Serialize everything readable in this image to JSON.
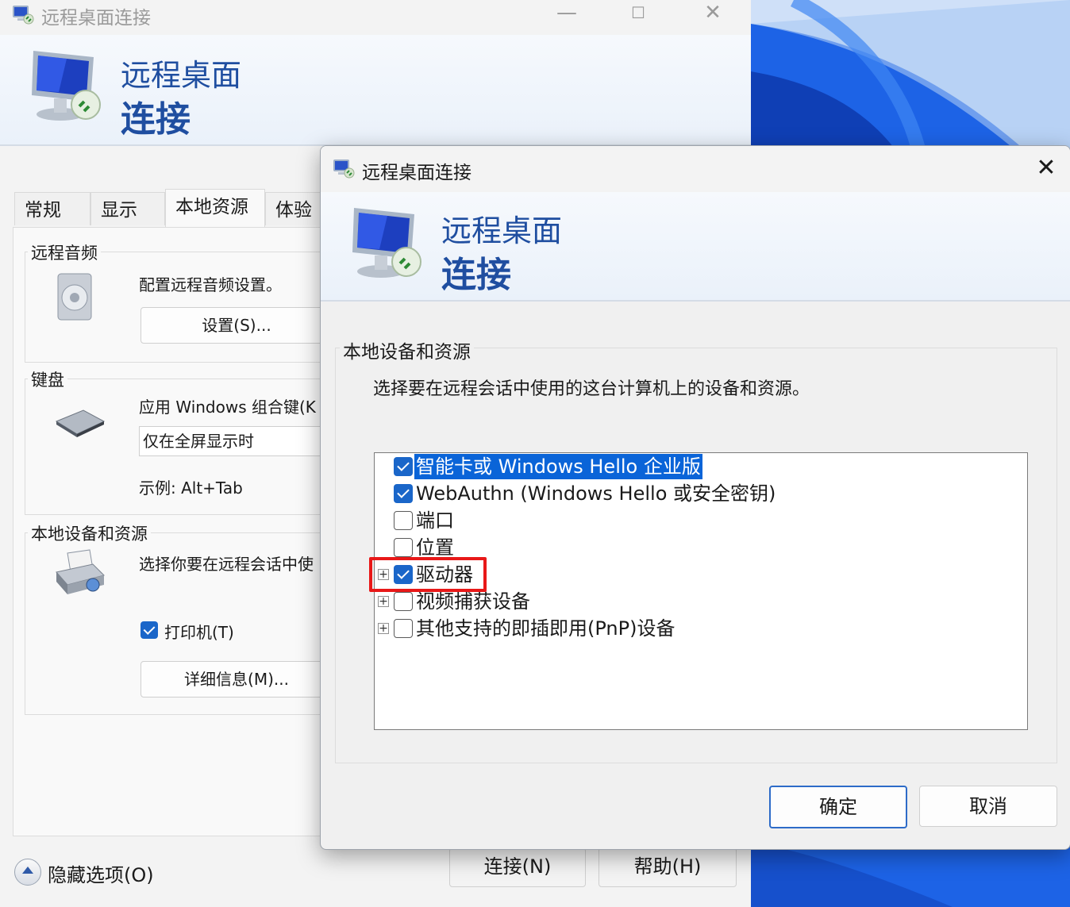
{
  "back_window": {
    "title": "远程桌面连接",
    "controls": {
      "minimize": "—",
      "maximize": "☐",
      "close": "✕"
    },
    "banner": {
      "line1": "远程桌面",
      "line2": "连接"
    },
    "tabs": [
      {
        "label": "常规"
      },
      {
        "label": "显示"
      },
      {
        "label": "本地资源"
      },
      {
        "label": "体验"
      }
    ],
    "audio": {
      "group": "远程音频",
      "desc": "配置远程音频设置。",
      "button": "设置(S)..."
    },
    "keyboard": {
      "group": "键盘",
      "desc": "应用 Windows 组合键(K",
      "combo_value": "仅在全屏显示时",
      "example": "示例: Alt+Tab"
    },
    "local_devices": {
      "group": "本地设备和资源",
      "desc": "选择你要在远程会话中使",
      "printer_label": "打印机(T)",
      "printer_checked": true,
      "details_button": "详细信息(M)..."
    },
    "hide_options": "隐藏选项(O)",
    "connect_button": "连接(N)",
    "help_button": "帮助(H)"
  },
  "dialog": {
    "title": "远程桌面连接",
    "close": "✕",
    "banner": {
      "line1": "远程桌面",
      "line2": "连接"
    },
    "group_title": "本地设备和资源",
    "description": "选择要在远程会话中使用的这台计算机上的设备和资源。",
    "items": [
      {
        "label": "智能卡或 Windows Hello 企业版",
        "checked": true,
        "expandable": false,
        "selected": true
      },
      {
        "label": "WebAuthn (Windows Hello 或安全密钥)",
        "checked": true,
        "expandable": false,
        "selected": false
      },
      {
        "label": "端口",
        "checked": false,
        "expandable": false,
        "selected": false
      },
      {
        "label": "位置",
        "checked": false,
        "expandable": false,
        "selected": false
      },
      {
        "label": "驱动器",
        "checked": true,
        "expandable": true,
        "selected": false,
        "highlighted": true
      },
      {
        "label": "视频捕获设备",
        "checked": false,
        "expandable": true,
        "selected": false
      },
      {
        "label": "其他支持的即插即用(PnP)设备",
        "checked": false,
        "expandable": true,
        "selected": false
      }
    ],
    "expander_symbol": "+",
    "ok_button": "确定",
    "cancel_button": "取消"
  },
  "colors": {
    "accent": "#1a66c9",
    "selection": "#0a64d8",
    "highlight": "#e81818",
    "banner_text": "#1f4ea0",
    "wallpaper": "#1b5fe0"
  }
}
